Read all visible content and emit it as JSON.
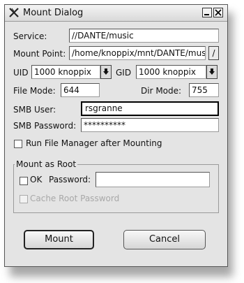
{
  "window": {
    "title": "Mount Dialog",
    "minimize_glyph": "_",
    "close_glyph": "X"
  },
  "form": {
    "service": {
      "label": "Service:",
      "value": "//DANTE/music"
    },
    "mount_point": {
      "label": "Mount Point:",
      "value": "/home/knoppix/mnt/DANTE/music",
      "browse_label": "/"
    },
    "uid": {
      "label": "UID",
      "value": "1000 knoppix"
    },
    "gid": {
      "label": "GID",
      "value": "1000 knoppix"
    },
    "file_mode": {
      "label": "File Mode:",
      "value": "644"
    },
    "dir_mode": {
      "label": "Dir Mode:",
      "value": "755"
    },
    "smb_user": {
      "label": "SMB User:",
      "value": "rsgranne"
    },
    "smb_password": {
      "label": "SMB Password:",
      "value": "**********"
    },
    "run_file_manager": {
      "label": "Run File Manager after Mounting",
      "checked": false
    }
  },
  "mount_as_root": {
    "title": "Mount as Root",
    "ok": {
      "label": "OK",
      "checked": false
    },
    "password": {
      "label": "Password:",
      "value": ""
    },
    "cache_root_password": {
      "label": "Cache Root Password",
      "checked": false,
      "enabled": false
    }
  },
  "buttons": {
    "mount": "Mount",
    "cancel": "Cancel"
  },
  "icons": {
    "app": "x-window-icon",
    "minimize": "minimize-icon",
    "close": "close-icon",
    "uid_dropdown": "dropdown-arrow-icon",
    "gid_dropdown": "dropdown-arrow-icon"
  }
}
